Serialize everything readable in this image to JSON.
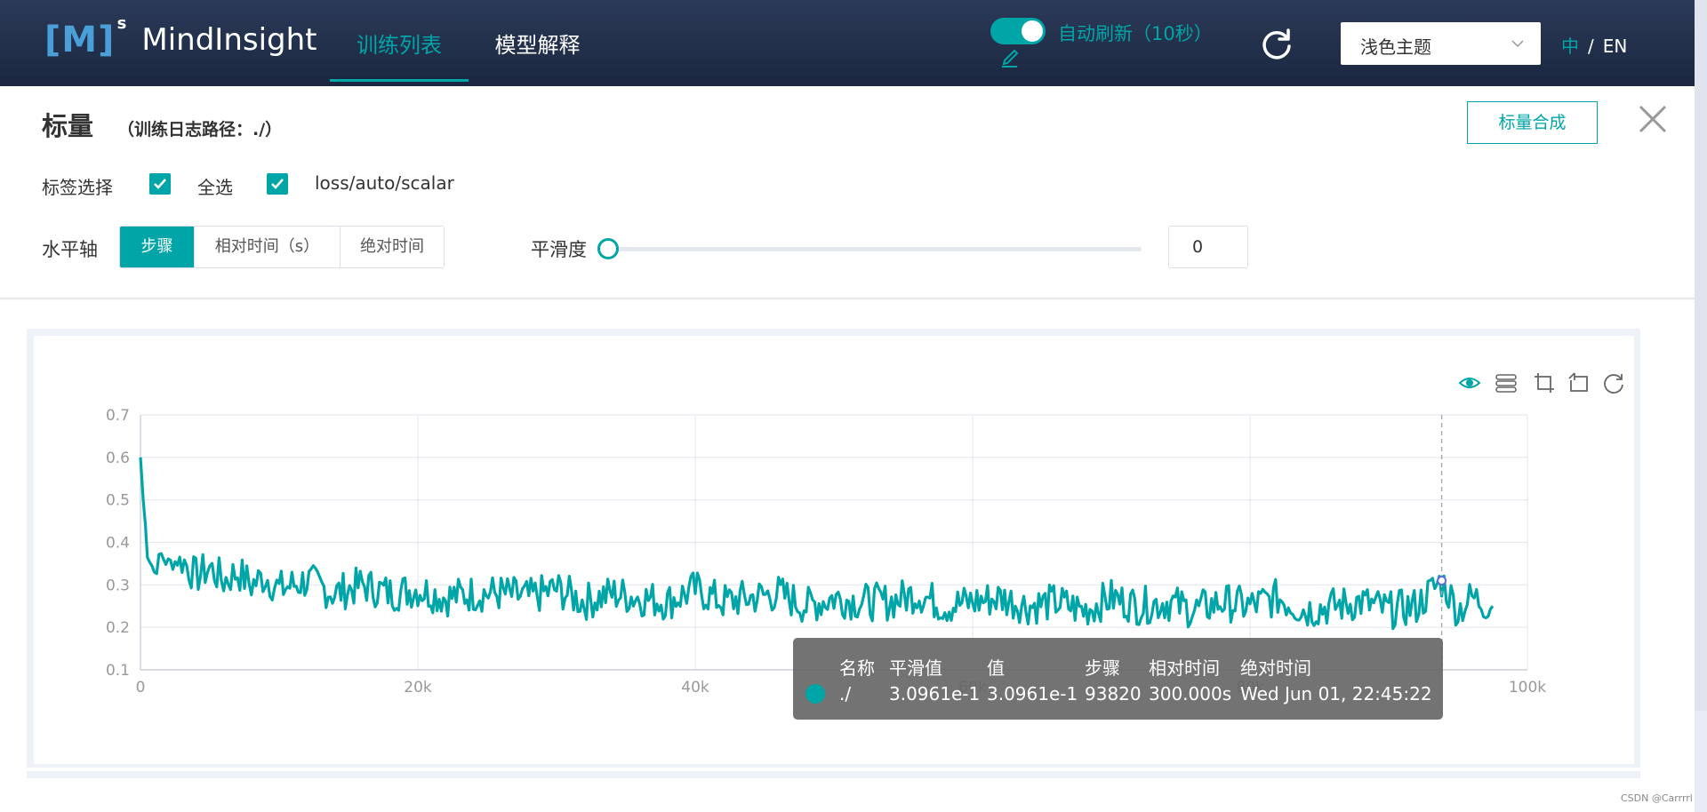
{
  "header": {
    "logo_mark": "[M]",
    "logo_sup": "s",
    "logo_text": "MindInsight",
    "tabs": [
      {
        "label": "训练列表",
        "active": true
      },
      {
        "label": "模型解释",
        "active": false
      }
    ],
    "auto_refresh_label": "自动刷新（10秒）",
    "auto_refresh_on": true,
    "theme_select_value": "浅色主题",
    "lang_zh": "中",
    "lang_sep": "/",
    "lang_en": "EN",
    "accent_color": "#00a5a7"
  },
  "panel": {
    "title": "标量",
    "subtitle": "（训练日志路径：./）",
    "compose_button": "标量合成",
    "tag_select_label": "标签选择",
    "select_all_label": "全选",
    "tag_name": "loss/auto/scalar",
    "x_axis_label": "水平轴",
    "x_axis_options": [
      {
        "label": "步骤",
        "active": true
      },
      {
        "label": "相对时间（s）",
        "active": false
      },
      {
        "label": "绝对时间",
        "active": false
      }
    ],
    "smoothing_label": "平滑度",
    "smoothing_value": "0"
  },
  "chart_data": {
    "type": "line",
    "xlim": [
      0,
      100000
    ],
    "ylim": [
      0.1,
      0.7
    ],
    "x_ticks": [
      "0",
      "20k",
      "40k",
      "60k",
      "80k",
      "100k"
    ],
    "y_ticks": [
      "0.1",
      "0.2",
      "0.3",
      "0.4",
      "0.5",
      "0.6",
      "0.7"
    ],
    "grid": true,
    "line_color": "#00a5a7",
    "series": [
      {
        "x": [
          0,
          200,
          500,
          1000,
          1500,
          2000,
          3000,
          4000,
          5000,
          6000,
          7000,
          8000,
          9000,
          10000,
          12000,
          14000,
          16000,
          18000,
          20000,
          22000,
          24000,
          26000,
          28000,
          30000,
          32000,
          34000,
          36000,
          38000,
          40000,
          42000,
          44000,
          46000,
          48000,
          50000,
          52000,
          54000,
          56000,
          58000,
          60000,
          62000,
          64000,
          66000,
          68000,
          70000,
          72000,
          74000,
          76000,
          78000,
          80000,
          82000,
          84000,
          86000,
          88000,
          90000,
          92000,
          93820,
          95000,
          96000,
          97500
        ],
        "y": [
          0.6,
          0.5,
          0.38,
          0.33,
          0.37,
          0.35,
          0.36,
          0.32,
          0.34,
          0.31,
          0.33,
          0.3,
          0.32,
          0.29,
          0.31,
          0.28,
          0.3,
          0.28,
          0.29,
          0.27,
          0.28,
          0.28,
          0.27,
          0.29,
          0.26,
          0.28,
          0.27,
          0.26,
          0.29,
          0.26,
          0.27,
          0.28,
          0.25,
          0.27,
          0.26,
          0.26,
          0.28,
          0.25,
          0.26,
          0.27,
          0.25,
          0.26,
          0.24,
          0.27,
          0.25,
          0.26,
          0.24,
          0.26,
          0.25,
          0.27,
          0.24,
          0.25,
          0.26,
          0.24,
          0.25,
          0.31,
          0.24,
          0.27,
          0.25
        ]
      }
    ],
    "crosshair_x": 93820
  },
  "tooltip": {
    "headers": [
      "名称",
      "平滑值",
      "值",
      "步骤",
      "相对时间",
      "绝对时间"
    ],
    "values": [
      "./",
      "3.0961e-1",
      "3.0961e-1",
      "93820",
      "300.000s",
      "Wed Jun 01, 22:45:22"
    ]
  },
  "chart_toolbar": [
    "eye-icon",
    "legend-icon",
    "crop-icon",
    "undo-icon",
    "reset-icon"
  ],
  "footer_note": "CSDN @Carrrrl"
}
